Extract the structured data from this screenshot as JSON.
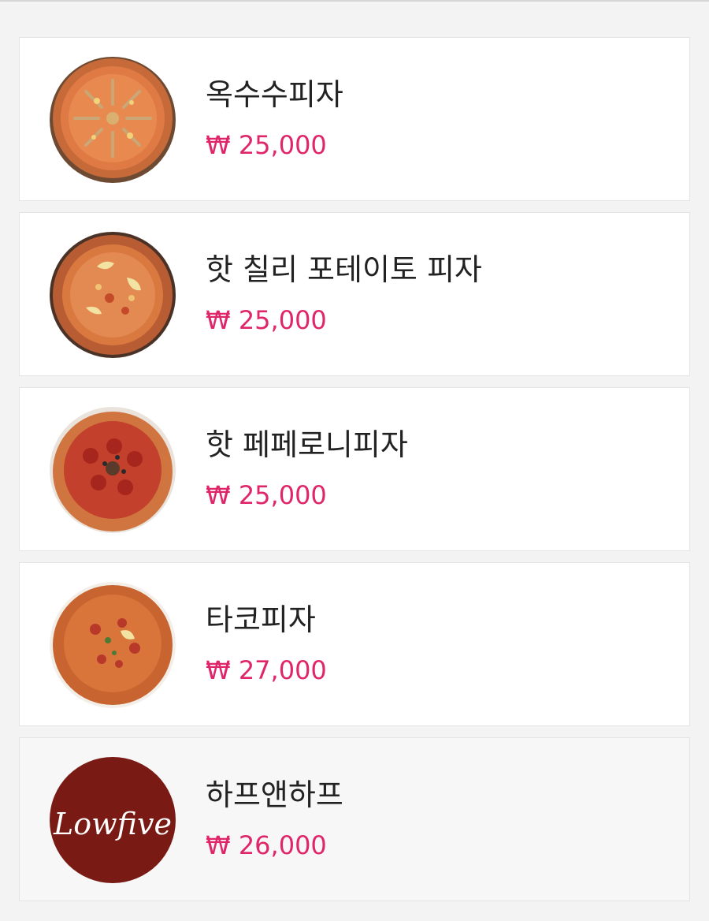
{
  "colors": {
    "price": "#e0266a",
    "name": "#222222",
    "card_bg": "#ffffff",
    "page_bg": "#f3f3f3",
    "logo_bg": "#7a1a14"
  },
  "menu": {
    "items": [
      {
        "name": "옥수수피자",
        "price": "₩ 25,000",
        "image": "pizza-photo"
      },
      {
        "name": "핫 칠리 포테이토 피자",
        "price": "₩ 25,000",
        "image": "pizza-photo"
      },
      {
        "name": "핫 페페로니피자",
        "price": "₩ 25,000",
        "image": "pizza-photo"
      },
      {
        "name": "타코피자",
        "price": "₩ 27,000",
        "image": "pizza-photo"
      },
      {
        "name": "하프앤하프",
        "price": "₩ 26,000",
        "image": "brand-logo",
        "logo_text": "Lowfive"
      }
    ]
  }
}
